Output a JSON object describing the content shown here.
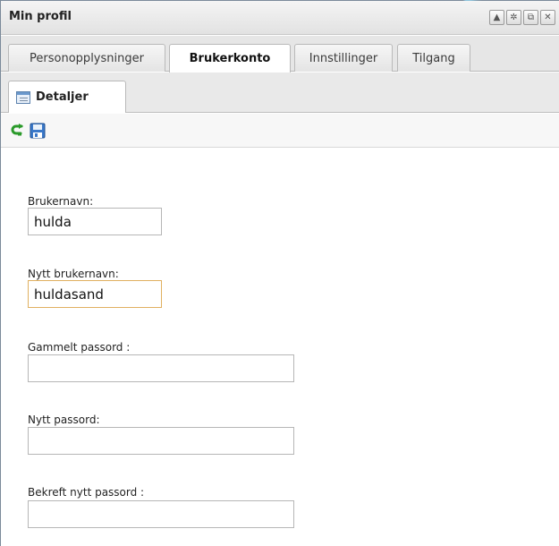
{
  "window": {
    "title": "Min profil",
    "tools": [
      "collapse-icon",
      "gear-icon",
      "restore-icon",
      "close-icon"
    ]
  },
  "tabs": [
    {
      "label": "Personopplysninger",
      "active": false
    },
    {
      "label": "Brukerkonto",
      "active": true
    },
    {
      "label": "Innstillinger",
      "active": false
    },
    {
      "label": "Tilgang",
      "active": false
    }
  ],
  "subtab": {
    "label": "Detaljer"
  },
  "toolbar": {
    "icons": [
      "undo-icon",
      "save-icon"
    ]
  },
  "form": {
    "username_label": "Brukernavn:",
    "username_value": "hulda",
    "new_username_label": "Nytt brukernavn:",
    "new_username_value": "huldasand",
    "old_password_label": "Gammelt passord :",
    "old_password_value": "",
    "new_password_label": "Nytt passord:",
    "new_password_value": "",
    "confirm_password_label": "Bekreft nytt passord :",
    "confirm_password_value": ""
  },
  "colors": {
    "accent_border": "#e0b060",
    "undo_green": "#2a9a2a",
    "save_blue": "#3a78c9"
  }
}
